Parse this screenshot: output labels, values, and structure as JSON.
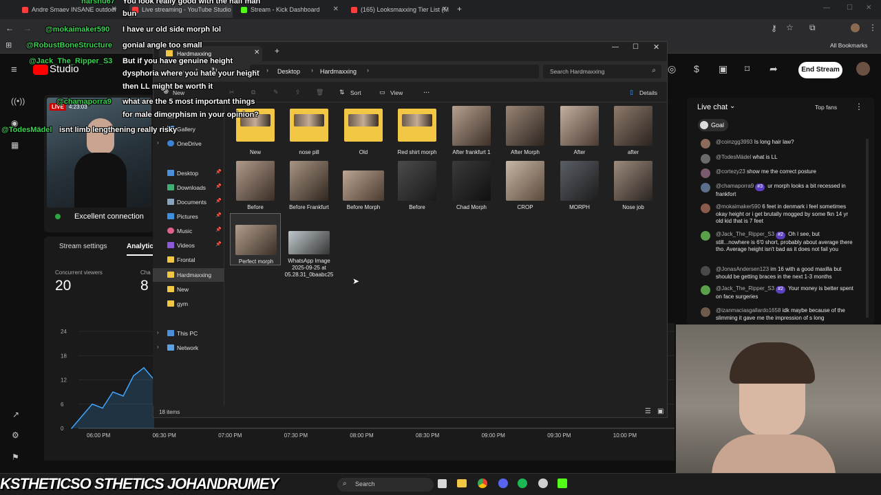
{
  "browser": {
    "tabs": [
      {
        "title": "Andre Smaev INSANE outdoor",
        "color": "#ff3d3d"
      },
      {
        "title": "Live streaming - YouTube Studio",
        "color": "#ff3d3d"
      },
      {
        "title": "Stream - Kick Dashboard",
        "color": "#53fc18"
      },
      {
        "title": "(165) Looksmaxxing Tier List (M",
        "color": "#ff3d3d"
      }
    ],
    "all_bookmarks": "All Bookmarks"
  },
  "studio": {
    "logo": "Studio",
    "end_stream": "End Stream",
    "live_badge": "LIVE",
    "live_time": "4:23:03",
    "connection": "Excellent connection",
    "tabs": {
      "settings": "Stream settings",
      "analytics": "Analytics"
    },
    "concurrent_label": "Concurrent viewers",
    "concurrent_value": "20",
    "chat_label": "Cha",
    "chat_value": "8"
  },
  "chart_data": {
    "type": "line",
    "title": "",
    "xlabel": "",
    "ylabel": "",
    "categories": [
      "06:00 PM",
      "06:30 PM",
      "07:00 PM",
      "07:30 PM",
      "08:00 PM",
      "08:30 PM",
      "09:00 PM",
      "09:30 PM",
      "10:00 PM"
    ],
    "y_ticks": [
      "24",
      "18",
      "12",
      "6",
      "0"
    ],
    "ylim": [
      0,
      24
    ],
    "series": [
      {
        "name": "",
        "x": [
          "05:50 PM",
          "05:55 PM",
          "06:00 PM",
          "06:05 PM",
          "06:10 PM",
          "06:15 PM",
          "06:20 PM",
          "06:25 PM",
          "06:30 PM"
        ],
        "values": [
          0,
          3,
          6,
          5,
          9,
          8,
          13,
          15,
          12
        ]
      }
    ]
  },
  "explorer": {
    "tab_title": "Hardmaxxing",
    "breadcrumb": [
      "Desktop",
      "Hardmaxxing"
    ],
    "search_placeholder": "Search Hardmaxxing",
    "toolbar": {
      "new": "New",
      "sort": "Sort",
      "view": "View",
      "more": "...",
      "details": "Details"
    },
    "nav": {
      "home": "Home",
      "gallery": "Gallery",
      "onedrive": "OneDrive",
      "desktop": "Desktop",
      "downloads": "Downloads",
      "documents": "Documents",
      "pictures": "Pictures",
      "music": "Music",
      "videos": "Videos",
      "frontal": "Frontal",
      "hardmaxxing": "Hardmaxxing",
      "new": "New",
      "gym": "gym",
      "thispc": "This PC",
      "network": "Network"
    },
    "items": [
      {
        "name": "New",
        "kind": "folder"
      },
      {
        "name": "nose pill",
        "kind": "folder"
      },
      {
        "name": "Old",
        "kind": "folder"
      },
      {
        "name": "Red shirt morph",
        "kind": "folder"
      },
      {
        "name": "After frankfurt 1",
        "kind": "image"
      },
      {
        "name": "After Morph",
        "kind": "image"
      },
      {
        "name": "After",
        "kind": "image"
      },
      {
        "name": "after",
        "kind": "image"
      },
      {
        "name": "Before",
        "kind": "image"
      },
      {
        "name": "Before Frankfurt",
        "kind": "image"
      },
      {
        "name": "Before Morph",
        "kind": "image"
      },
      {
        "name": "Before",
        "kind": "image"
      },
      {
        "name": "Chad Morph",
        "kind": "image"
      },
      {
        "name": "CROP",
        "kind": "image"
      },
      {
        "name": "MORPH",
        "kind": "image"
      },
      {
        "name": "Nose job",
        "kind": "image"
      },
      {
        "name": "Perfect morph",
        "kind": "image"
      },
      {
        "name": "WhatsApp Image 2025-09-25 at 05.28.31_0baabc25",
        "kind": "image"
      }
    ],
    "status": "18 items"
  },
  "chat": {
    "title": "Live chat",
    "top_fans": "Top fans",
    "goal": "Goal",
    "messages": [
      {
        "user": "@coinzgg3993",
        "text": "Is long hair law?"
      },
      {
        "user": "@TodesMädel",
        "text": "what is LL"
      },
      {
        "user": "@cortezy23",
        "text": "show me the correct posture"
      },
      {
        "user": "@chamaporra9",
        "badge": "#3",
        "text": "ur morph looks a bit recessed in frankfort"
      },
      {
        "user": "@mokaimaker590",
        "text": "6 feet in denmark i feel sometimes okay height or i get brutally mogged by some fkn 14 yr old kid that is 7 feet"
      },
      {
        "user": "@Jack_The_Ripper_S3",
        "badge": "#2",
        "text": "Oh I see, but still...nowhere is 6'0 short, probably about average there tho. Average height isn't bad as it does not fail you"
      },
      {
        "user": "@JonasAndersen123",
        "text": "im 16 with a good maxilla but should be getting braces in the next 1-3 months"
      },
      {
        "user": "@Jack_The_Ripper_S3",
        "badge": "#2",
        "text": "Your money is better spent on face surgeries"
      },
      {
        "user": "@izanmaciasgallardo1658",
        "text": "idk maybe because of the slimming it gave me the impression of s long"
      }
    ]
  },
  "overlay": {
    "lines": [
      {
        "user": "harshu67",
        "text": "You look really good with the half man"
      },
      {
        "user": "",
        "text": "bun"
      },
      {
        "user": "@mokaimaker590",
        "text": "I have ur old side morph lol"
      },
      {
        "user": "@RobustBoneStructure",
        "text": "gonial angle too small"
      },
      {
        "user": "@Jack_The_Ripper_S3",
        "text": "But if you have genuine height"
      },
      {
        "user": "",
        "text": "dysphoria where you hate your height"
      },
      {
        "user": "",
        "text": "then LL might be worth it"
      },
      {
        "user": "@chamaporra9",
        "text": "what are the 5 most important things"
      },
      {
        "user": "",
        "text": "for male dimorphism in your opinion?"
      },
      {
        "user": "@TodesMädel",
        "text": "isnt limb lengthening really risky"
      }
    ]
  },
  "banner": {
    "text": "KSTHETICSO  STHETICS  JOHANDRUMEY"
  },
  "taskbar": {
    "search": "Search"
  }
}
